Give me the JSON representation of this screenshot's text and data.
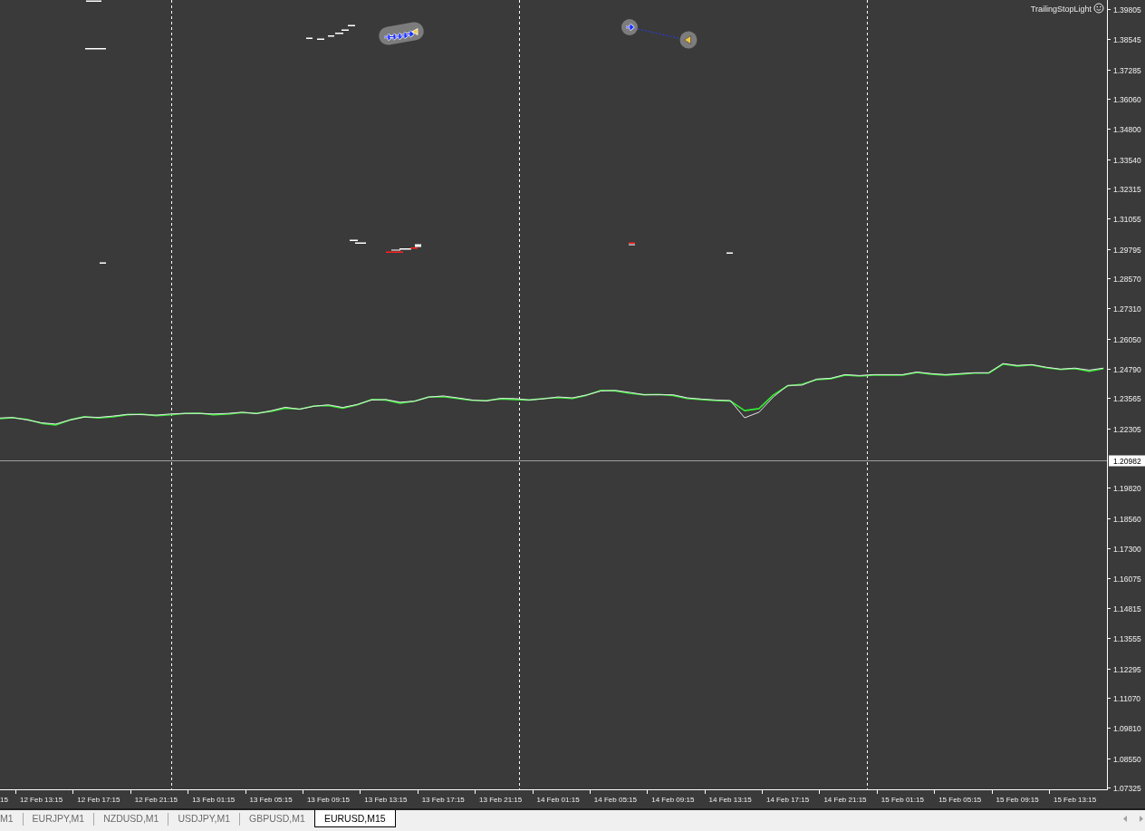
{
  "chart": {
    "indicator_label": "TrailingStopLight",
    "cut_tick_label": "15",
    "chart_data": {
      "type": "line",
      "categories": [
        null,
        null,
        null,
        "12 Feb 13:15",
        null,
        null,
        null,
        "12 Feb 17:15",
        null,
        null,
        null,
        "12 Feb 21:15",
        null,
        null,
        null,
        "13 Feb 01:15",
        null,
        null,
        null,
        "13 Feb 05:15",
        null,
        null,
        null,
        "13 Feb 09:15",
        null,
        null,
        null,
        "13 Feb 13:15",
        null,
        null,
        null,
        "13 Feb 17:15",
        null,
        null,
        null,
        "13 Feb 21:15",
        null,
        null,
        null,
        "14 Feb 01:15",
        null,
        null,
        null,
        "14 Feb 05:15",
        null,
        null,
        null,
        "14 Feb 09:15",
        null,
        null,
        null,
        "14 Feb 13:15",
        null,
        null,
        null,
        "14 Feb 17:15",
        null,
        null,
        null,
        "14 Feb 21:15",
        null,
        null,
        null,
        "15 Feb 01:15",
        null,
        null,
        null,
        "15 Feb 05:15",
        null,
        null,
        null,
        "15 Feb 09:15",
        null,
        null,
        null,
        "15 Feb 13:15",
        null,
        null
      ],
      "series": [
        {
          "color": "#33ee33",
          "values": [
            1.2271,
            1.2275,
            1.2268,
            1.2252,
            1.2245,
            1.2266,
            1.2279,
            1.2274,
            1.2279,
            1.2288,
            1.229,
            1.2284,
            1.2287,
            1.2293,
            1.2294,
            1.2288,
            1.229,
            1.2297,
            1.2294,
            1.2302,
            1.2315,
            1.2311,
            1.2324,
            1.2326,
            1.2315,
            1.2329,
            1.2351,
            1.2349,
            1.2336,
            1.2344,
            1.2362,
            1.2363,
            1.2355,
            1.2348,
            1.2347,
            1.2354,
            1.2351,
            1.2349,
            1.2355,
            1.2359,
            1.2355,
            1.2369,
            1.2389,
            1.2387,
            1.2377,
            1.2371,
            1.2372,
            1.2368,
            1.2355,
            1.2351,
            1.2347,
            1.2345,
            1.2305,
            1.2313,
            1.237,
            1.2408,
            1.2415,
            1.2434,
            1.2438,
            1.2453,
            1.2449,
            1.2453,
            1.2453,
            1.2453,
            1.2464,
            1.2457,
            1.2453,
            1.2457,
            1.2461,
            1.2461,
            1.2499,
            1.2491,
            1.2495,
            1.2484,
            1.2476,
            1.248,
            1.2469,
            1.248
          ]
        },
        {
          "color": "#e6e6e6",
          "values": [
            1.2274,
            1.2276,
            1.2266,
            1.2254,
            1.2249,
            1.2266,
            1.2278,
            1.2277,
            1.2282,
            1.2289,
            1.2288,
            1.2286,
            1.2291,
            1.2293,
            1.2293,
            1.2291,
            1.2293,
            1.2298,
            1.2292,
            1.2304,
            1.2319,
            1.2311,
            1.2323,
            1.2329,
            1.2318,
            1.233,
            1.2349,
            1.2351,
            1.234,
            1.2344,
            1.2361,
            1.2366,
            1.2358,
            1.2349,
            1.2345,
            1.2356,
            1.2355,
            1.2349,
            1.2354,
            1.2362,
            1.2358,
            1.237,
            1.2387,
            1.2389,
            1.2381,
            1.2371,
            1.2371,
            1.2371,
            1.2358,
            1.2353,
            1.2349,
            1.2347,
            1.2275,
            1.2298,
            1.2362,
            1.241,
            1.2411,
            1.2436,
            1.244,
            1.2455,
            1.2451,
            1.2455,
            1.2455,
            1.2455,
            1.2466,
            1.2459,
            1.2455,
            1.2459,
            1.2463,
            1.2463,
            1.2501,
            1.2493,
            1.2497,
            1.2486,
            1.2478,
            1.2482,
            1.2474,
            1.2482
          ]
        }
      ],
      "ylim": [
        1.0721,
        1.4018
      ],
      "yticks": [
        1.39805,
        1.38545,
        1.37285,
        {
          "value": 1.3606,
          "label": "1.36060"
        },
        {
          "value": 1.348,
          "label": "1.34800"
        },
        {
          "value": 1.3354,
          "label": "1.33540"
        },
        1.32315,
        1.31055,
        1.29795,
        {
          "value": 1.2857,
          "label": "1.28570"
        },
        {
          "value": 1.2731,
          "label": "1.27310"
        },
        {
          "value": 1.2605,
          "label": "1.26050"
        },
        {
          "value": 1.2479,
          "label": "1.24790"
        },
        1.23565,
        1.22305,
        {
          "value": 1.1982,
          "label": "1.19820"
        },
        {
          "value": 1.1856,
          "label": "1.18560"
        },
        {
          "value": 1.173,
          "label": "1.17300"
        },
        1.16075,
        1.14815,
        1.13555,
        1.12295,
        {
          "value": 1.1107,
          "label": "1.11070"
        },
        {
          "value": 1.0981,
          "label": "1.09810"
        },
        {
          "value": 1.0855,
          "label": "1.08550"
        },
        1.07325
      ],
      "ref_lines": [
        {
          "axis": "y",
          "value": 1.20982,
          "label": "1.20982",
          "color": "#a0a0a0"
        }
      ]
    }
  },
  "tabs": [
    {
      "label": "M1",
      "selected": false
    },
    {
      "label": "EURJPY,M1",
      "selected": false
    },
    {
      "label": "NZDUSD,M1",
      "selected": false
    },
    {
      "label": "USDJPY,M1",
      "selected": false
    },
    {
      "label": "GBPUSD,M1",
      "selected": false
    },
    {
      "label": "EURUSD,M15",
      "selected": true
    }
  ]
}
